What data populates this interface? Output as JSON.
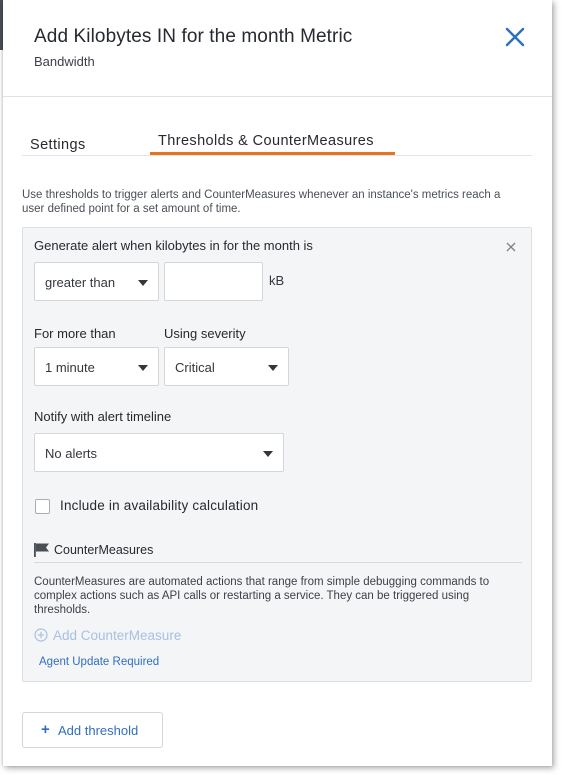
{
  "header": {
    "title": "Add Kilobytes IN for the month Metric",
    "subtitle": "Bandwidth",
    "close_icon": "close-icon"
  },
  "tabs": [
    {
      "label": "Settings",
      "active": false
    },
    {
      "label": "Thresholds & CounterMeasures",
      "active": true
    }
  ],
  "colors": {
    "accent": "#e8731f",
    "link": "#2f6fc0",
    "disabled_link": "#a8c0e2"
  },
  "intro": "Use thresholds to trigger alerts and CounterMeasures whenever an instance's metrics reach a user defined point for a set amount of time.",
  "threshold": {
    "heading": "Generate alert when kilobytes in for the month is",
    "comparison": "greater than",
    "value": "",
    "unit": "kB",
    "duration_label": "For more than",
    "duration": "1 minute",
    "severity_label": "Using severity",
    "severity": "Critical",
    "timeline_label": "Notify with alert timeline",
    "timeline": "No alerts",
    "availability_label": "Include in availability calculation",
    "availability_checked": false,
    "countermeasures": {
      "title": "CounterMeasures",
      "icon": "flag-icon",
      "description": "CounterMeasures are automated actions that range from simple debugging commands to complex actions such as API calls or restarting a service. They can be triggered using thresholds.",
      "add_label": "Add CounterMeasure",
      "agent_notice": "Agent Update Required"
    }
  },
  "add_threshold": {
    "plus": "+",
    "label": "Add threshold"
  }
}
